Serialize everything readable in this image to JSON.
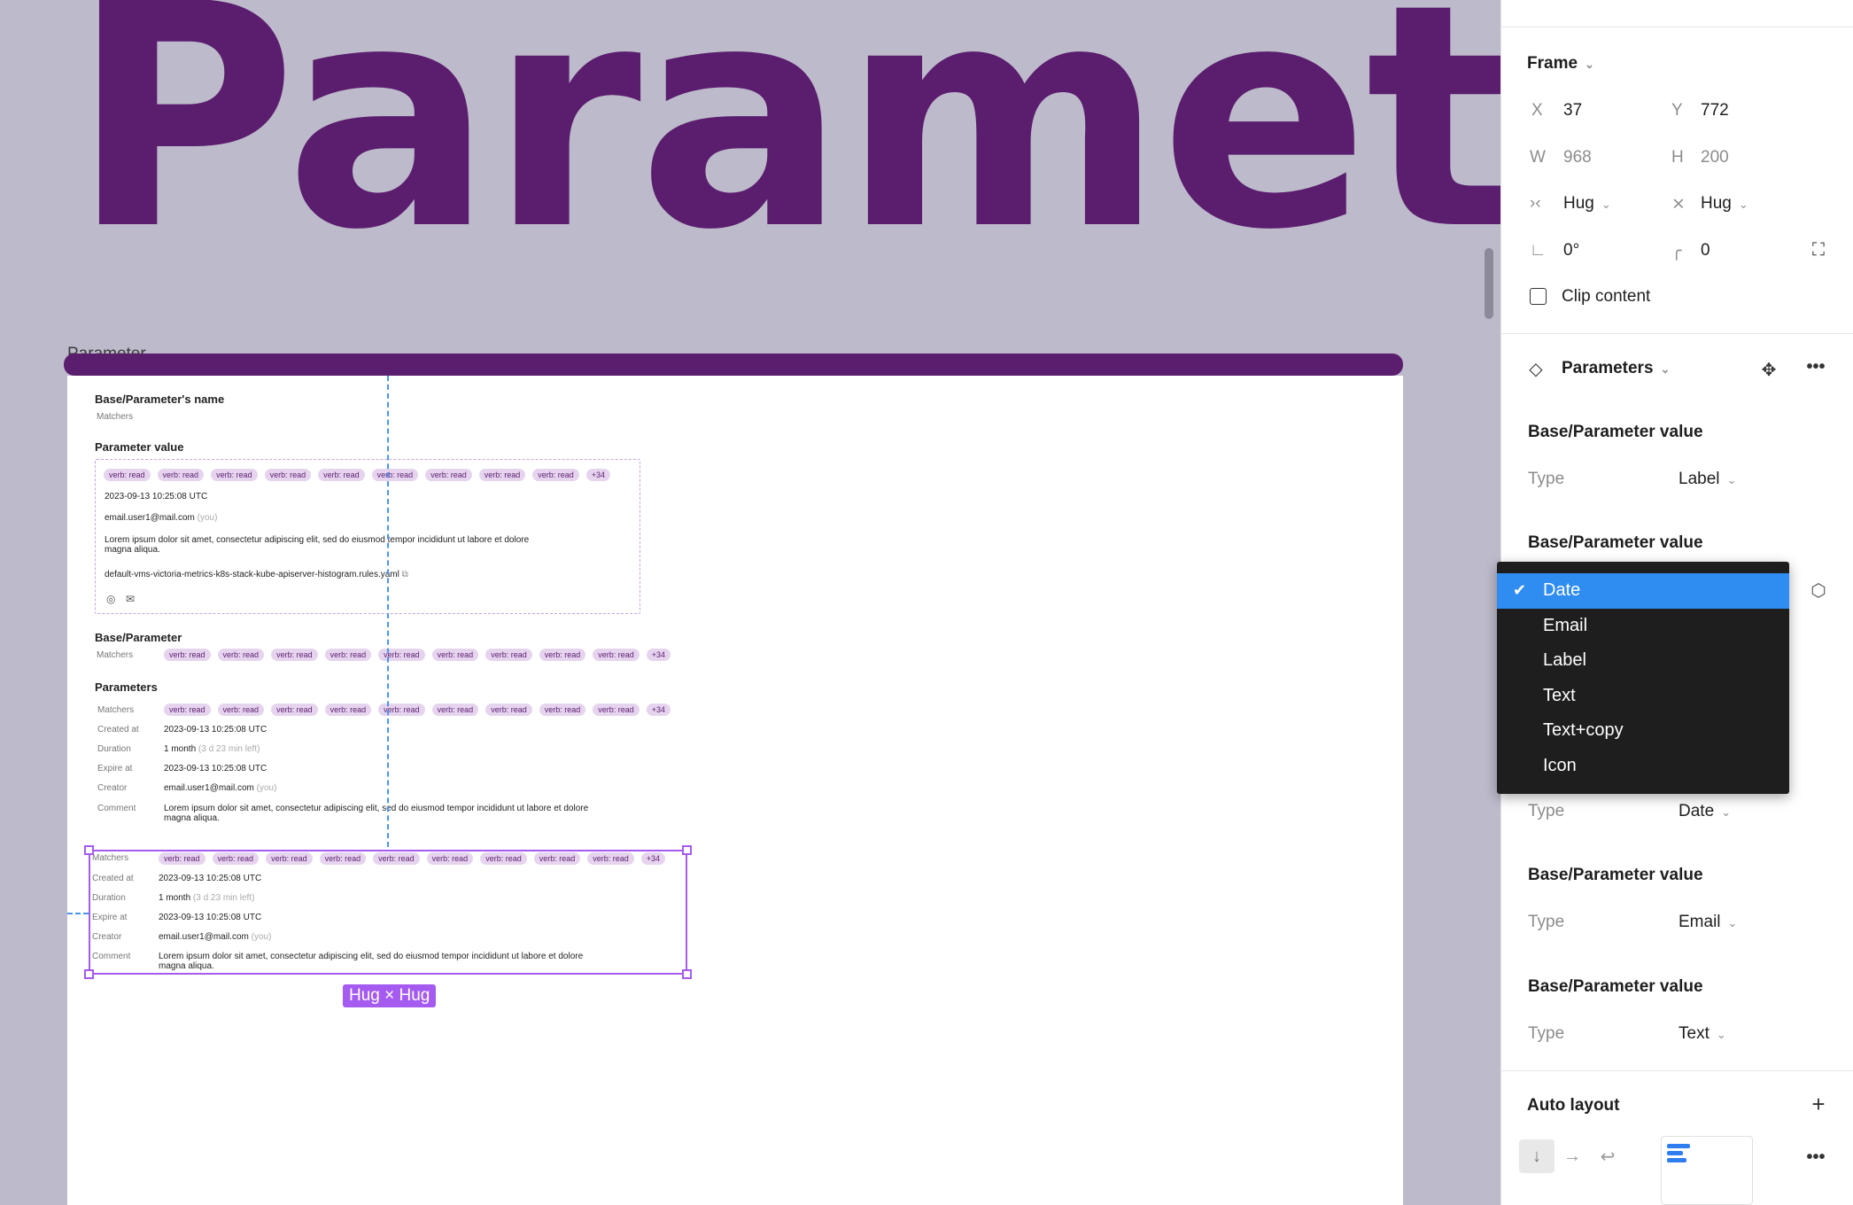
{
  "canvas": {
    "big_title": "Parameter",
    "frame_label": "Parameter",
    "hug_badge": "Hug × Hug",
    "card": {
      "name_title": "Base/Parameter's name",
      "name_sub": "Matchers",
      "value_title": "Parameter value",
      "chip_label": "verb: read",
      "chip_more": "+34",
      "value_date": "2023-09-13 10:25:08 UTC",
      "value_email": "email.user1@mail.com",
      "you": "(you)",
      "lorem_1": "Lorem ipsum dolor sit amet, consectetur adipiscing elit, sed do eiusmod tempor incididunt ut labore et dolore",
      "lorem_2": "magna aliqua.",
      "file": "default-vms-victoria-metrics-k8s-stack-kube-apiserver-histogram.rules.yaml",
      "base_title": "Base/Parameter",
      "matchers": "Matchers",
      "params_title": "Parameters",
      "created_at": "Created at",
      "duration": "Duration",
      "duration_value": "1 month",
      "duration_left": "(3 d 23 min left)",
      "expire_at": "Expire at",
      "creator": "Creator",
      "comment": "Comment"
    }
  },
  "panel": {
    "frame": {
      "title": "Frame",
      "x_label": "X",
      "x_value": "37",
      "y_label": "Y",
      "y_value": "772",
      "w_label": "W",
      "w_value": "968",
      "h_label": "H",
      "h_value": "200",
      "hsize": "Hug",
      "vsize": "Hug",
      "rotation": "0°",
      "radius": "0",
      "clip_content": "Clip content"
    },
    "parameters": {
      "title": "Parameters",
      "items": [
        {
          "name": "Base/Parameter value",
          "type_label": "Type",
          "type_value": "Label"
        },
        {
          "name": "Base/Parameter value",
          "type_label": "Type",
          "type_value": "Date"
        },
        {
          "name": "Base/Parameter value",
          "type_label": "Type",
          "type_value": "Email"
        },
        {
          "name": "Base/Parameter value",
          "type_label": "Type",
          "type_value": "Text"
        }
      ]
    },
    "dropdown": {
      "options": [
        "Date",
        "Email",
        "Label",
        "Text",
        "Text+copy",
        "Icon"
      ],
      "selected": "Date"
    },
    "auto_layout": {
      "title": "Auto layout"
    }
  }
}
